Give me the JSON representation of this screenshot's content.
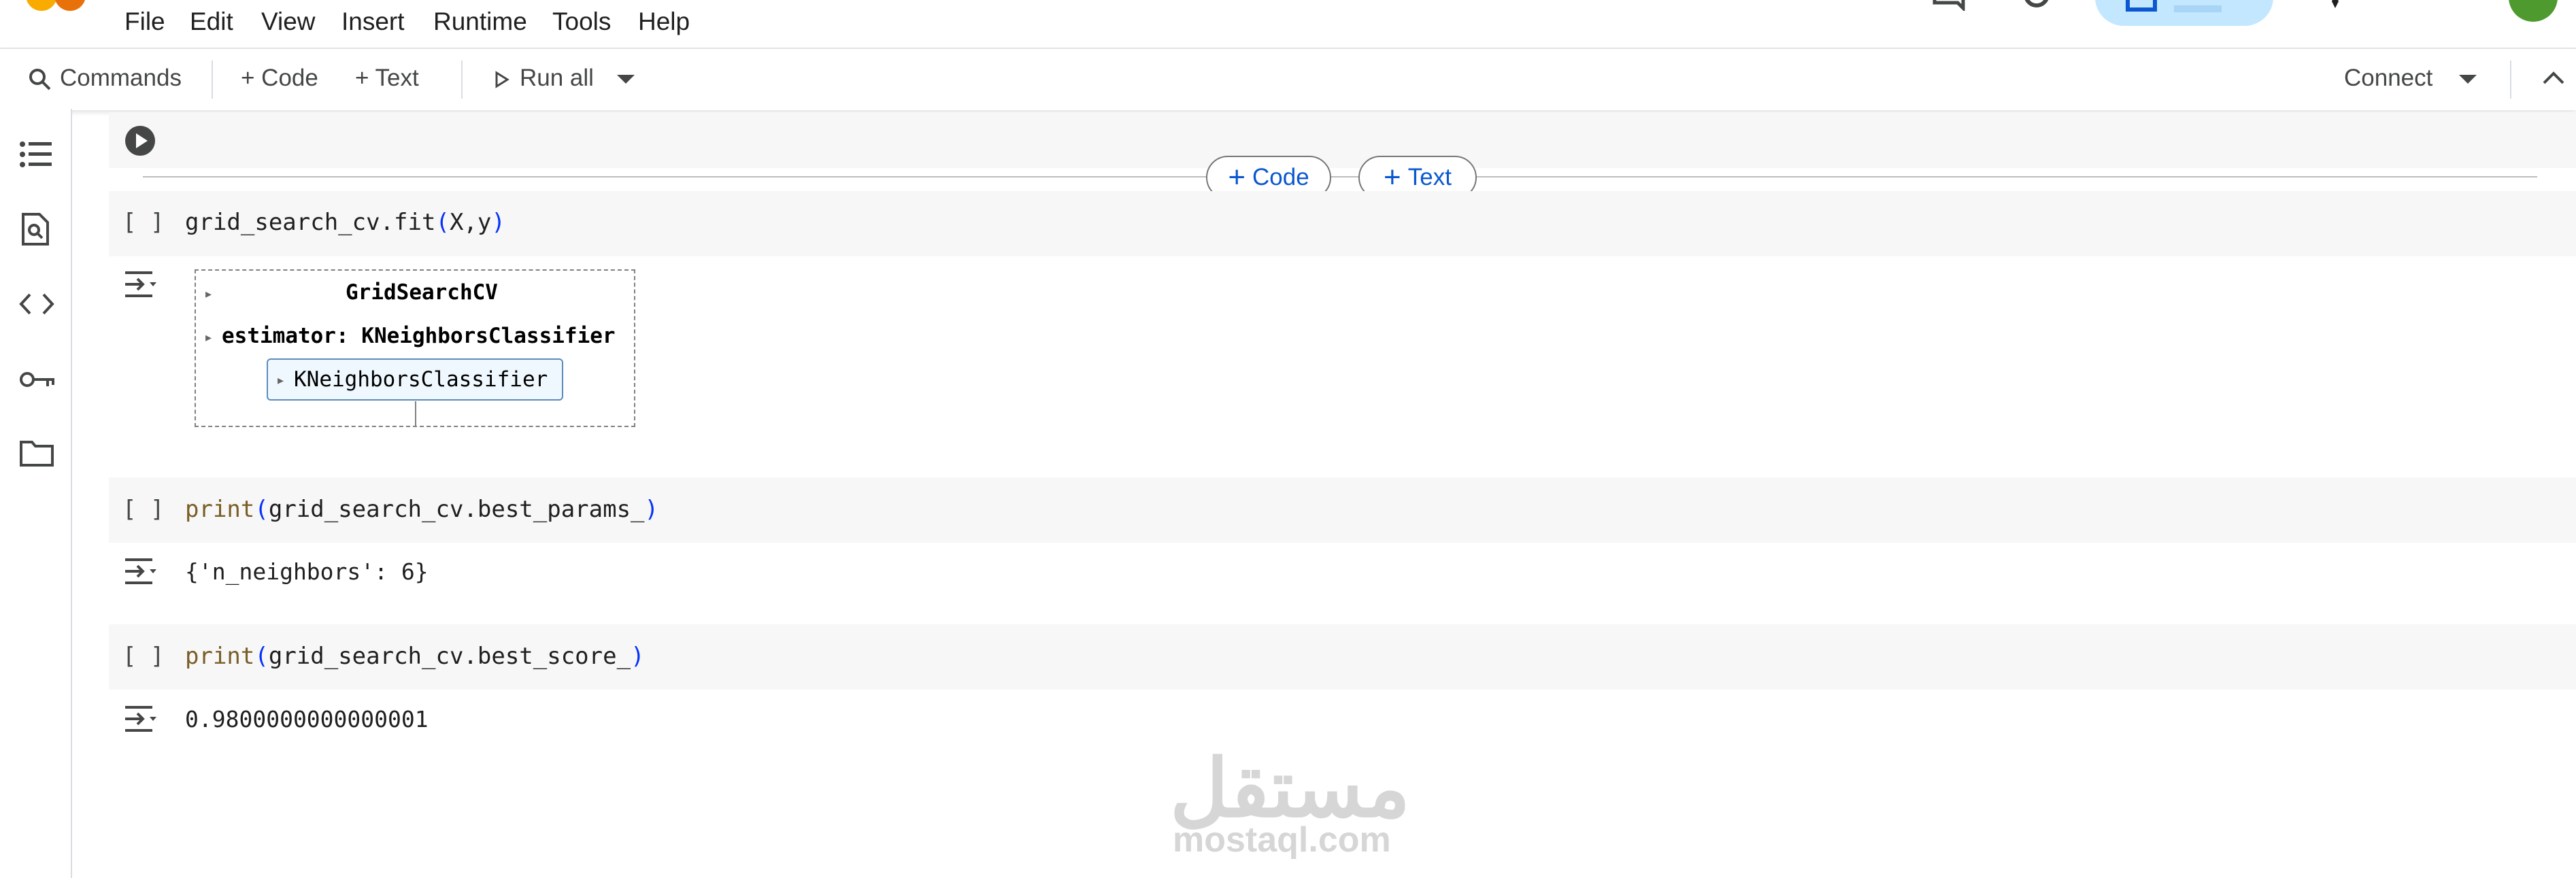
{
  "menubar": {
    "items": [
      "File",
      "Edit",
      "View",
      "Insert",
      "Runtime",
      "Tools",
      "Help"
    ]
  },
  "toolbar": {
    "commands_label": "Commands",
    "add_code_label": "+ Code",
    "add_text_label": "+ Text",
    "run_all_label": "Run all",
    "connect_label": "Connect"
  },
  "insert_pills": {
    "code_label": "Code",
    "text_label": "Text"
  },
  "cells": {
    "fit": {
      "bracket": "[ ]",
      "code_plain": "grid_search_cv.fit",
      "code_args": "X,y"
    },
    "params": {
      "bracket": "[ ]",
      "print_kw": "print",
      "code_inner": "grid_search_cv.best_params_",
      "output": "{'n_neighbors': 6}"
    },
    "score": {
      "bracket": "[ ]",
      "print_kw": "print",
      "code_inner": "grid_search_cv.best_score_",
      "output": "0.9800000000000001"
    }
  },
  "estimator_widget": {
    "title": "GridSearchCV",
    "estimator_label": "estimator: KNeighborsClassifier",
    "inner_label": "KNeighborsClassifier"
  },
  "watermark": {
    "arabic": "مستقل",
    "latin": "mostaql.com"
  },
  "colors": {
    "accent_blue": "#0b57d0",
    "share_pill": "#c2e7ff",
    "cell_bg": "#f7f7f7",
    "print_keyword": "#795e26",
    "paren": "#0431fa"
  }
}
